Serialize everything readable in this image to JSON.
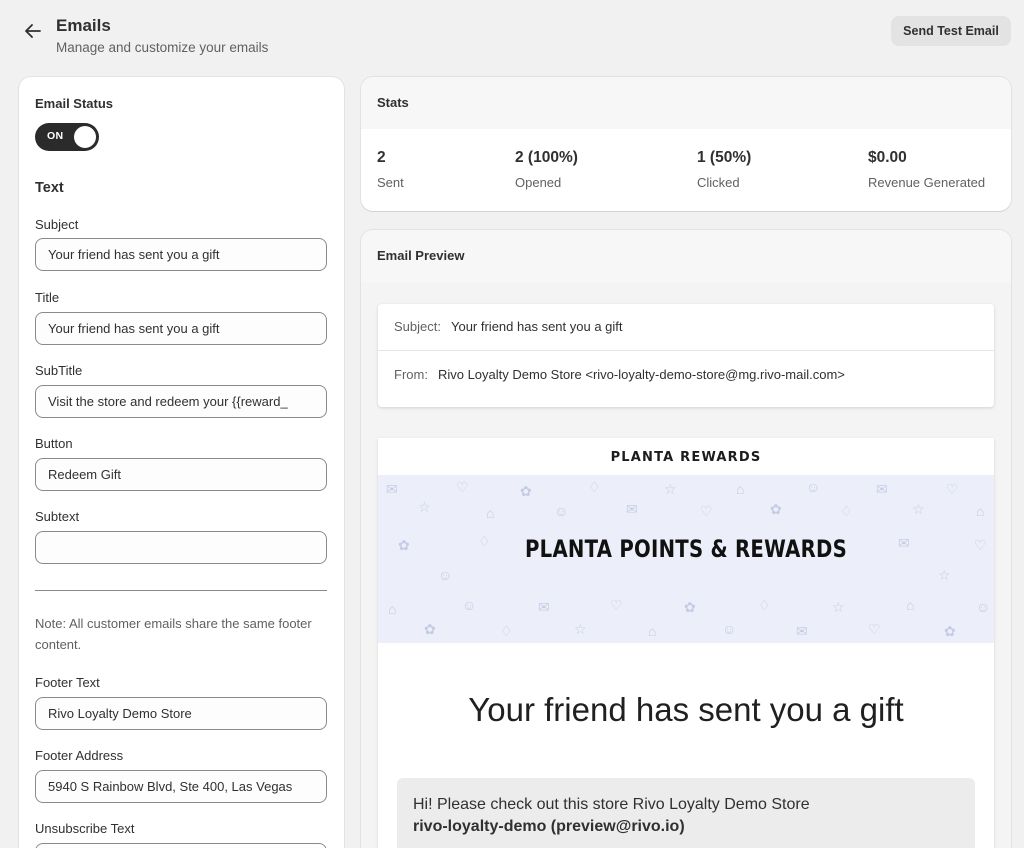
{
  "header": {
    "title": "Emails",
    "subtitle": "Manage and customize your emails",
    "test_button": "Send Test Email"
  },
  "left": {
    "status_title": "Email Status",
    "toggle_label": "ON",
    "toggle_on": true,
    "text_section": "Text",
    "subject_label": "Subject",
    "subject_value": "Your friend has sent you a gift",
    "title_label": "Title",
    "title_value": "Your friend has sent you a gift",
    "subtitle_label": "SubTitle",
    "subtitle_value": "Visit the store and redeem your {{reward_",
    "button_label": "Button",
    "button_value": "Redeem Gift",
    "subtext_label": "Subtext",
    "subtext_value": "",
    "note": "Note: All customer emails share the same footer content.",
    "footer_text_label": "Footer Text",
    "footer_text_value": "Rivo Loyalty Demo Store",
    "footer_address_label": "Footer Address",
    "footer_address_value": "5940 S Rainbow Blvd, Ste 400, Las Vegas",
    "unsubscribe_label": "Unsubscribe Text"
  },
  "stats": {
    "title": "Stats",
    "items": [
      {
        "value": "2",
        "label": "Sent"
      },
      {
        "value": "2 (100%)",
        "label": "Opened"
      },
      {
        "value": "1 (50%)",
        "label": "Clicked"
      },
      {
        "value": "$0.00",
        "label": "Revenue Generated"
      }
    ]
  },
  "preview": {
    "title": "Email Preview",
    "subject_key": "Subject:",
    "subject_val": "Your friend has sent you a gift",
    "from_key": "From:",
    "from_val": "Rivo Loyalty Demo Store <rivo-loyalty-demo-store@mg.rivo-mail.com>",
    "brand": "PLANTA REWARDS",
    "banner": "PLANTA POINTS & REWARDS",
    "heading": "Your friend has sent you a gift",
    "message_line1": "Hi! Please check out this store Rivo Loyalty Demo Store",
    "message_line2": "rivo-loyalty-demo (preview@rivo.io)"
  },
  "icons": {
    "back": "arrow-left-icon",
    "banner_pattern": "gift-pattern-icons"
  },
  "colors": {
    "background": "#f1f1f1",
    "toggle": "#2b2b2b",
    "banner": "#eceff9"
  }
}
